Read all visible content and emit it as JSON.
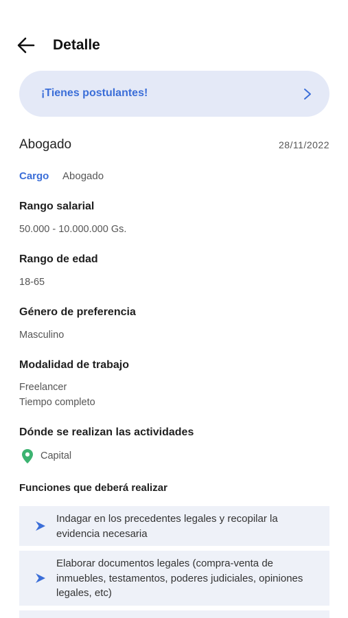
{
  "header": {
    "title": "Detalle"
  },
  "banner": {
    "text": "¡Tienes postulantes!"
  },
  "job": {
    "title": "Abogado",
    "date": "28/11/2022"
  },
  "cargo": {
    "label": "Cargo",
    "value": "Abogado"
  },
  "sections": {
    "salary": {
      "title": "Rango salarial",
      "value": "50.000 - 10.000.000 Gs."
    },
    "age": {
      "title": "Rango de edad",
      "value": "18-65"
    },
    "gender": {
      "title": "Género de preferencia",
      "value": "Masculino"
    },
    "modality": {
      "title": "Modalidad de trabajo",
      "values": [
        "Freelancer",
        "Tiempo completo"
      ]
    },
    "location": {
      "title": "Dónde se realizan las actividades",
      "value": "Capital"
    }
  },
  "functions": {
    "title": "Funciones que deberá realizar",
    "items": [
      "Indagar en los precedentes legales y recopilar la evidencia necesaria",
      "Elaborar documentos legales (compra-venta de inmuebles, testamentos, poderes judiciales, opiniones legales, etc)"
    ]
  },
  "colors": {
    "accent": "#3b6ed8",
    "banner_bg": "#e4e9f7",
    "item_bg": "#eef1f8",
    "pin": "#3cb371"
  },
  "icons": {
    "back": "arrow-left-icon",
    "chevron": "chevron-right-icon",
    "pin": "map-pin-icon",
    "item": "arrow-right-icon"
  }
}
